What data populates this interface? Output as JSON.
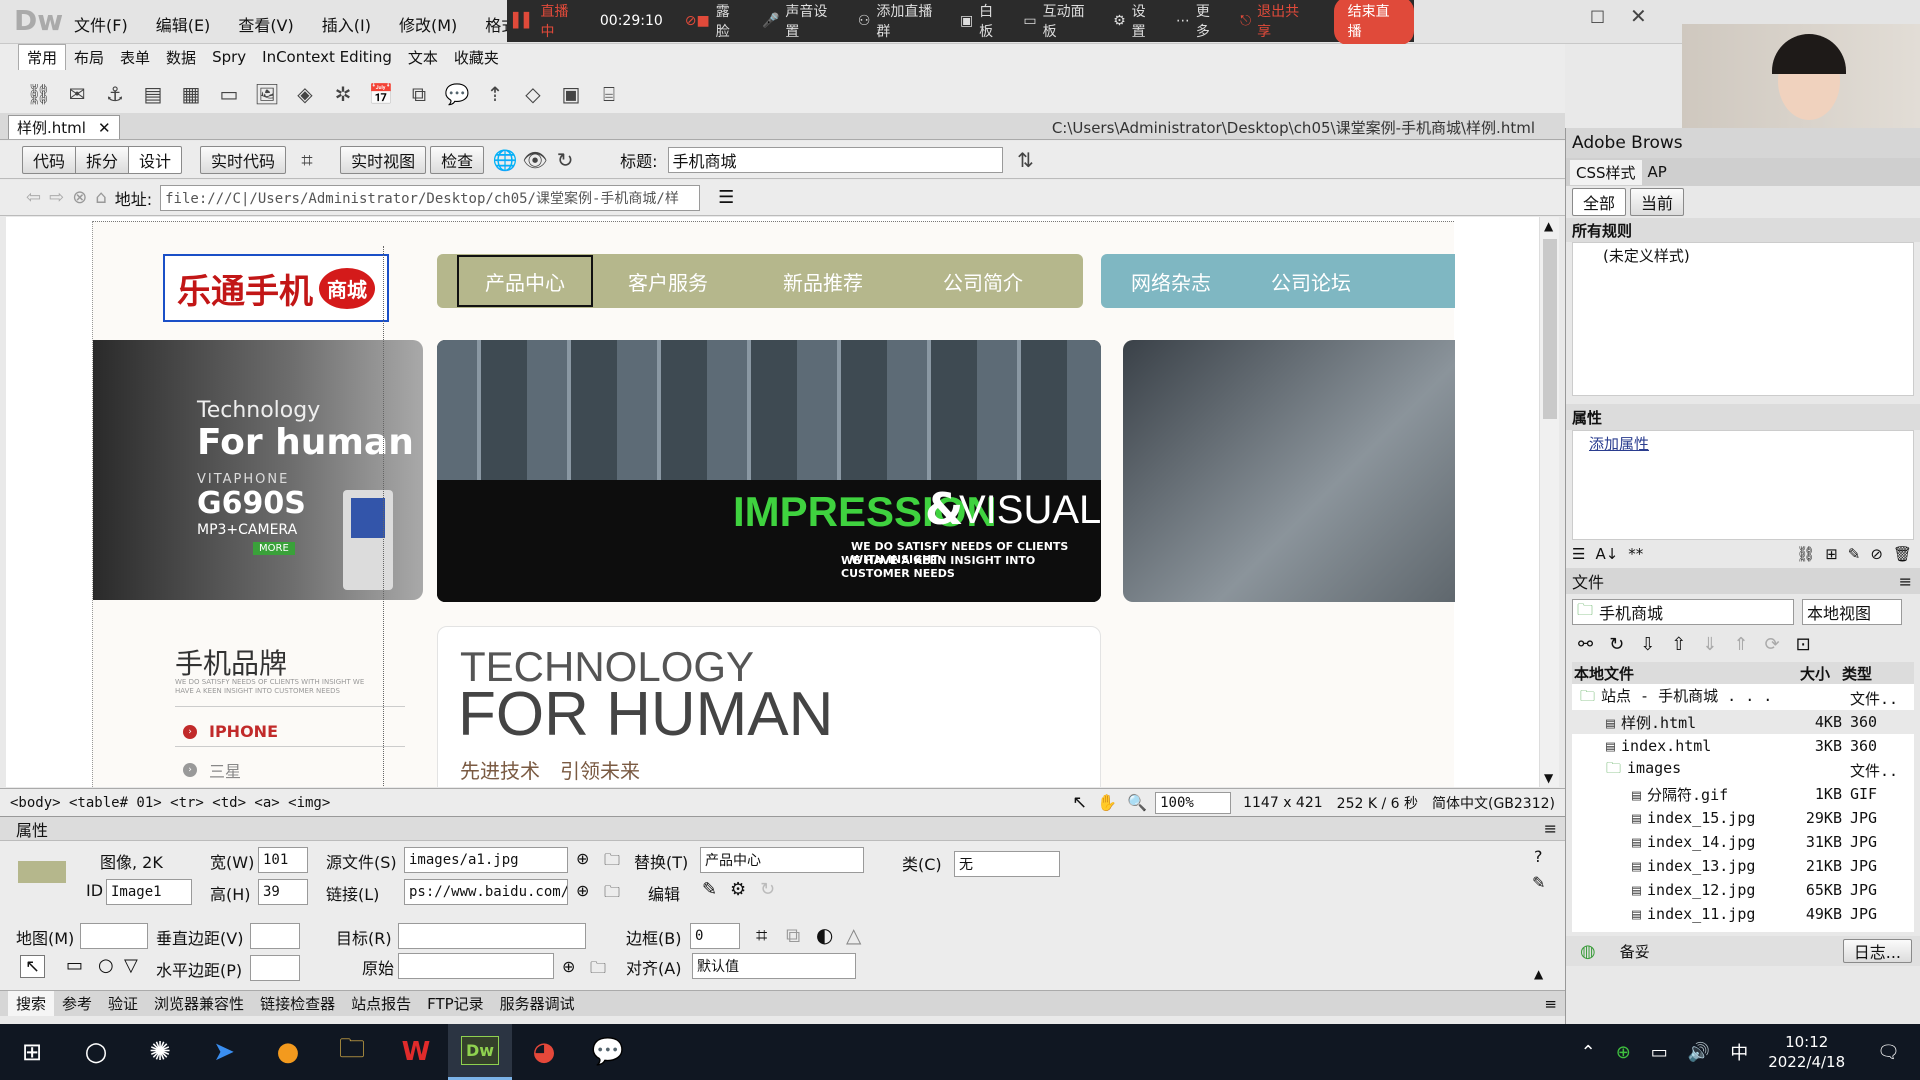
{
  "app": {
    "logo": "Dw"
  },
  "menu": [
    "文件(F)",
    "编辑(E)",
    "查看(V)",
    "插入(I)",
    "修改(M)",
    "格式(C)"
  ],
  "live": {
    "status": "直播中",
    "time": "00:29:10",
    "items": [
      "露脸",
      "声音设置",
      "添加直播群",
      "白板",
      "互动面板",
      "设置",
      "更多"
    ],
    "exit": "退出共享",
    "end": "结束直播"
  },
  "insert_tabs": [
    "常用",
    "布局",
    "表单",
    "数据",
    "Spry",
    "InContext Editing",
    "文本",
    "收藏夹"
  ],
  "doc": {
    "tab": "样例.html",
    "path": "C:\\Users\\Administrator\\Desktop\\ch05\\课堂案例-手机商城\\样例.html"
  },
  "doc_toolbar": {
    "code": "代码",
    "split": "拆分",
    "design": "设计",
    "live_code": "实时代码",
    "live_view": "实时视图",
    "inspect": "检查",
    "title_label": "标题:",
    "title_value": "手机商城"
  },
  "address": {
    "label": "地址:",
    "value": "file:///C|/Users/Administrator/Desktop/ch05/课堂案例-手机商城/样"
  },
  "page": {
    "logo": "乐通手机",
    "logo_badge": "商城",
    "nav_green": [
      "产品中心",
      "客户服务",
      "新品推荐",
      "公司简介"
    ],
    "nav_blue": [
      "网络杂志",
      "公司论坛"
    ],
    "promo_tech": "Technology",
    "promo_for": "For human",
    "promo_brand": "VITAPHONE",
    "promo_model": "G690S",
    "promo_spec": "MP3+CAMERA",
    "promo_more": "MORE",
    "banner_main": "IMPRESSION",
    "banner_amp": "&",
    "banner_visuals": "VISUALS",
    "banner_sub1": "WE DO SATISFY NEEDS OF CLIENTS WITH INSIGHT",
    "banner_sub2": "WE HAVE A KEEN INSIGHT INTO CUSTOMER NEEDS",
    "brand_title": "手机品牌",
    "brand_sub1": "WE DO SATISFY NEEDS OF CLIENTS WITH INSIGHT WE",
    "brand_sub2": "HAVE A KEEN INSIGHT INTO CUSTOMER NEEDS",
    "brands": [
      "IPHONE",
      "三星"
    ],
    "tech1": "TECHNOLOGY",
    "tech2": "FOR HUMAN",
    "tech_cn": "先进技术　引领未来"
  },
  "status_bar": {
    "tags": "<body> <table#  01> <tr> <td> <a> <img>",
    "zoom": "100%",
    "size": "1147 x 421",
    "weight": "252 K / 6 秒",
    "encoding": "简体中文(GB2312)"
  },
  "props": {
    "header": "属性",
    "image_label": "图像, 2K",
    "id_label": "ID",
    "id_value": "Image1",
    "w_label": "宽(W)",
    "w_value": "101",
    "h_label": "高(H)",
    "h_value": "39",
    "src_label": "源文件(S)",
    "src_value": "images/a1.jpg",
    "link_label": "链接(L)",
    "link_value": "ps://www.baidu.com/",
    "alt_label": "替换(T)",
    "alt_value": "产品中心",
    "edit_label": "编辑",
    "class_label": "类(C)",
    "class_value": "无",
    "map_label": "地图(M)",
    "vspace_label": "垂直边距(V)",
    "hspace_label": "水平边距(P)",
    "target_label": "目标(R)",
    "orig_label": "原始",
    "border_label": "边框(B)",
    "border_value": "0",
    "align_label": "对齐(A)",
    "align_value": "默认值"
  },
  "results_tabs": [
    "搜索",
    "参考",
    "验证",
    "浏览器兼容性",
    "链接检查器",
    "站点报告",
    "FTP记录",
    "服务器调试"
  ],
  "right": {
    "browserlab": "Adobe Brows",
    "css_tabs": [
      "CSS样式",
      "AP"
    ],
    "css_scope": [
      "全部",
      "当前"
    ],
    "all_rules": "所有规则",
    "rule": "(未定义样式)",
    "props_title": "属性",
    "add_prop": "添加属性",
    "files_title": "文件",
    "site": "手机商城",
    "view": "本地视图",
    "cols": [
      "本地文件",
      "大小",
      "类型"
    ],
    "tree": [
      {
        "name": "站点 - 手机商城 . . .",
        "size": "",
        "type": "文件..",
        "indent": 0
      },
      {
        "name": "样例.html",
        "size": "4KB",
        "type": "360",
        "indent": 1
      },
      {
        "name": "index.html",
        "size": "3KB",
        "type": "360",
        "indent": 1
      },
      {
        "name": "images",
        "size": "",
        "type": "文件..",
        "indent": 1
      },
      {
        "name": "分隔符.gif",
        "size": "1KB",
        "type": "GIF",
        "indent": 2
      },
      {
        "name": "index_15.jpg",
        "size": "29KB",
        "type": "JPG",
        "indent": 2
      },
      {
        "name": "index_14.jpg",
        "size": "31KB",
        "type": "JPG",
        "indent": 2
      },
      {
        "name": "index_13.jpg",
        "size": "21KB",
        "type": "JPG",
        "indent": 2
      },
      {
        "name": "index_12.jpg",
        "size": "65KB",
        "type": "JPG",
        "indent": 2
      },
      {
        "name": "index_11.jpg",
        "size": "49KB",
        "type": "JPG",
        "indent": 2
      }
    ],
    "footer_ready": "备妥",
    "footer_log": "日志..."
  },
  "taskbar": {
    "time": "10:12",
    "date": "2022/4/18",
    "ime": "中",
    "apps": [
      "windows",
      "cortana",
      "spotlight",
      "feishu",
      "media",
      "explorer",
      "wps",
      "dreamweaver",
      "chrome",
      "wechat"
    ]
  }
}
